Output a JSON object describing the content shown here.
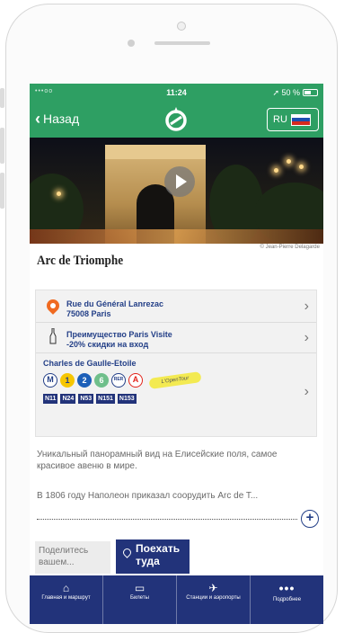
{
  "status_bar": {
    "carrier": "•••oo",
    "time": "11:24",
    "battery": "50 %",
    "battery_level": 0.5
  },
  "nav": {
    "back_label": "Назад",
    "language": "RU"
  },
  "hero": {
    "credit": "© Jean-Pierre Delagarde"
  },
  "place": {
    "title": "Arc de Triomphe"
  },
  "address": {
    "line1": "Rue du Général Lanrezac",
    "line2": "75008 Paris"
  },
  "promo": {
    "line1": "Преимущество Paris Visite",
    "line2": "-20% скидки на вход"
  },
  "transport": {
    "station": "Charles de Gaulle-Etoile",
    "lines": [
      "M",
      "1",
      "2",
      "6",
      "RER",
      "A"
    ],
    "tour": "L'OpenTour",
    "buses": [
      "N11",
      "N24",
      "N53",
      "N151",
      "N153"
    ]
  },
  "description": {
    "para1": "Уникальный панорамный вид на Елисейские поля, самое красивое авеню в мире.",
    "para2": "В 1806 году Наполеон приказал соорудить Arc de T..."
  },
  "actions": {
    "share_placeholder": "Поделитесь вашем...",
    "go_label_1": "Поехать",
    "go_label_2": "туда"
  },
  "tabs": [
    {
      "icon": "home-icon",
      "label": "Главная и маршрут"
    },
    {
      "icon": "ticket-icon",
      "label": "Билеты"
    },
    {
      "icon": "station-icon",
      "label": "Станции и аэропорты"
    },
    {
      "icon": "more-icon",
      "label": "Подробнее"
    }
  ],
  "colors": {
    "accent_green": "#2e9f63",
    "brand_blue": "#22337a",
    "pin_orange": "#f06a21"
  }
}
